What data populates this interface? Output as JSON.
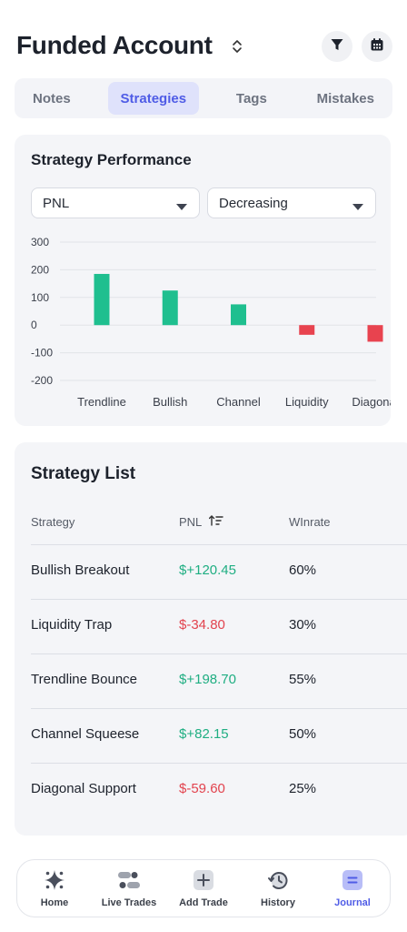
{
  "header": {
    "title": "Funded Account"
  },
  "tabs": [
    {
      "label": "Notes",
      "active": false
    },
    {
      "label": "Strategies",
      "active": true
    },
    {
      "label": "Tags",
      "active": false
    },
    {
      "label": "Mistakes",
      "active": false
    }
  ],
  "performance": {
    "title": "Strategy Performance",
    "metric_select": "PNL",
    "order_select": "Decreasing"
  },
  "chart_data": {
    "type": "bar",
    "categories": [
      "Trendline",
      "Bullish",
      "Channel",
      "Liquidity",
      "Diagonal"
    ],
    "values": [
      185,
      125,
      75,
      -35,
      -60
    ],
    "ylim": [
      -200,
      300
    ],
    "yticks": [
      300,
      200,
      100,
      0,
      -100,
      -200
    ],
    "grid": true,
    "colors": {
      "positive": "#1fbf8f",
      "negative": "#e8434f"
    }
  },
  "strategy_list": {
    "title": "Strategy List",
    "columns": [
      "Strategy",
      "PNL",
      "WInrate"
    ],
    "rows": [
      {
        "strategy": "Bullish Breakout",
        "pnl": "$+120.45",
        "winrate": "60%",
        "positive": true
      },
      {
        "strategy": "Liquidity Trap",
        "pnl": "$-34.80",
        "winrate": "30%",
        "positive": false
      },
      {
        "strategy": "Trendline Bounce",
        "pnl": "$+198.70",
        "winrate": "55%",
        "positive": true
      },
      {
        "strategy": "Channel Squeese",
        "pnl": "$+82.15",
        "winrate": "50%",
        "positive": true
      },
      {
        "strategy": "Diagonal Support",
        "pnl": "$-59.60",
        "winrate": "25%",
        "positive": false
      }
    ]
  },
  "nav": [
    {
      "label": "Home",
      "icon": "sparkle-icon",
      "active": false
    },
    {
      "label": "Live Trades",
      "icon": "live-trades-icon",
      "active": false
    },
    {
      "label": "Add Trade",
      "icon": "plus-icon",
      "active": false
    },
    {
      "label": "History",
      "icon": "history-icon",
      "active": false
    },
    {
      "label": "Journal",
      "icon": "journal-icon",
      "active": true
    }
  ],
  "colors": {
    "accent": "#4f5ce6",
    "positive": "#1fae82",
    "negative": "#e2434e"
  }
}
